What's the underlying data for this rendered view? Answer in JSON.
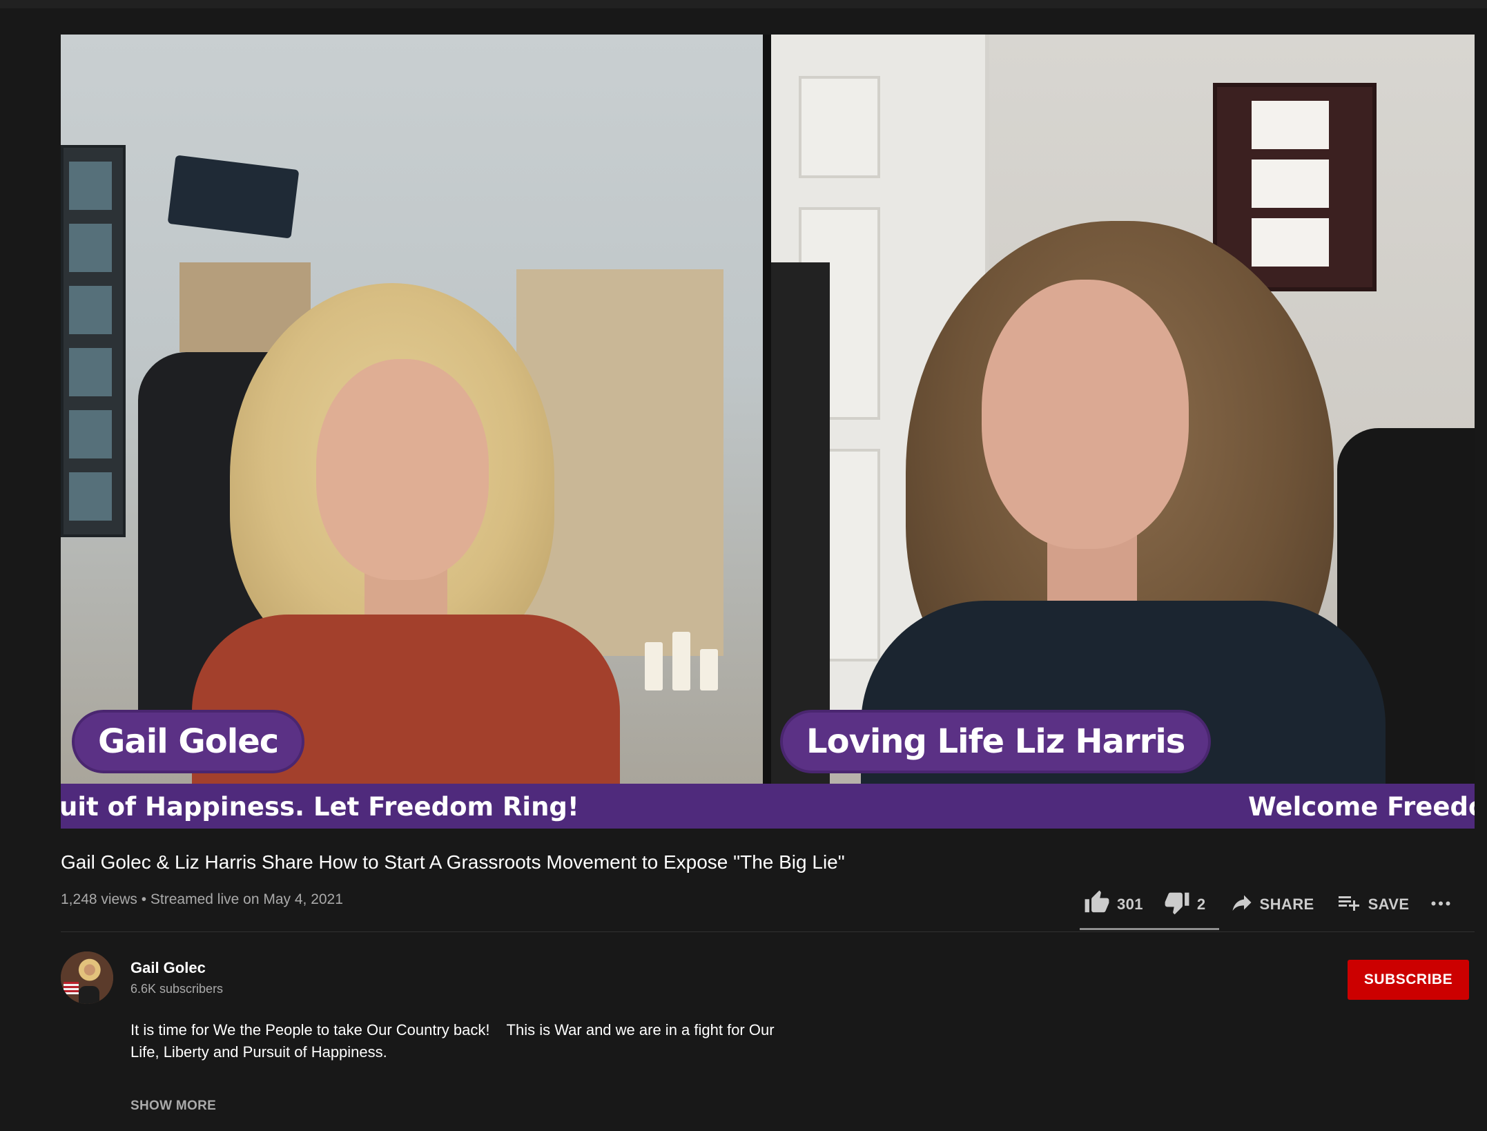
{
  "player": {
    "left_name": "Gail Golec",
    "right_name": "Loving Life Liz Harris",
    "ticker_left": "uit of Happiness. Let Freedom Ring!",
    "ticker_right": "Welcome Freedo"
  },
  "video": {
    "title": "Gail Golec & Liz Harris Share How to Start A Grassroots Movement to Expose \"The Big Lie\"",
    "meta": "1,248 views • Streamed live on May 4, 2021"
  },
  "actions": {
    "likes": "301",
    "dislikes": "2",
    "share_label": "SHARE",
    "save_label": "SAVE",
    "icons": [
      "thumb-up-icon",
      "thumb-down-icon",
      "share-icon",
      "playlist-add-icon",
      "more-icon"
    ]
  },
  "channel": {
    "name": "Gail Golec",
    "subscribers": "6.6K subscribers",
    "subscribe_label": "SUBSCRIBE",
    "subscribe_color": "#cc0000"
  },
  "description": {
    "lines": [
      "It is time for We the People to take Our Country back!    This is War and we are in a fight for Our",
      "Life, Liberty and Pursuit of Happiness."
    ],
    "show_more_label": "SHOW MORE"
  },
  "colors": {
    "background": "#181818",
    "lower_third": "#5b3185",
    "muted_text": "#aaaaaa"
  }
}
